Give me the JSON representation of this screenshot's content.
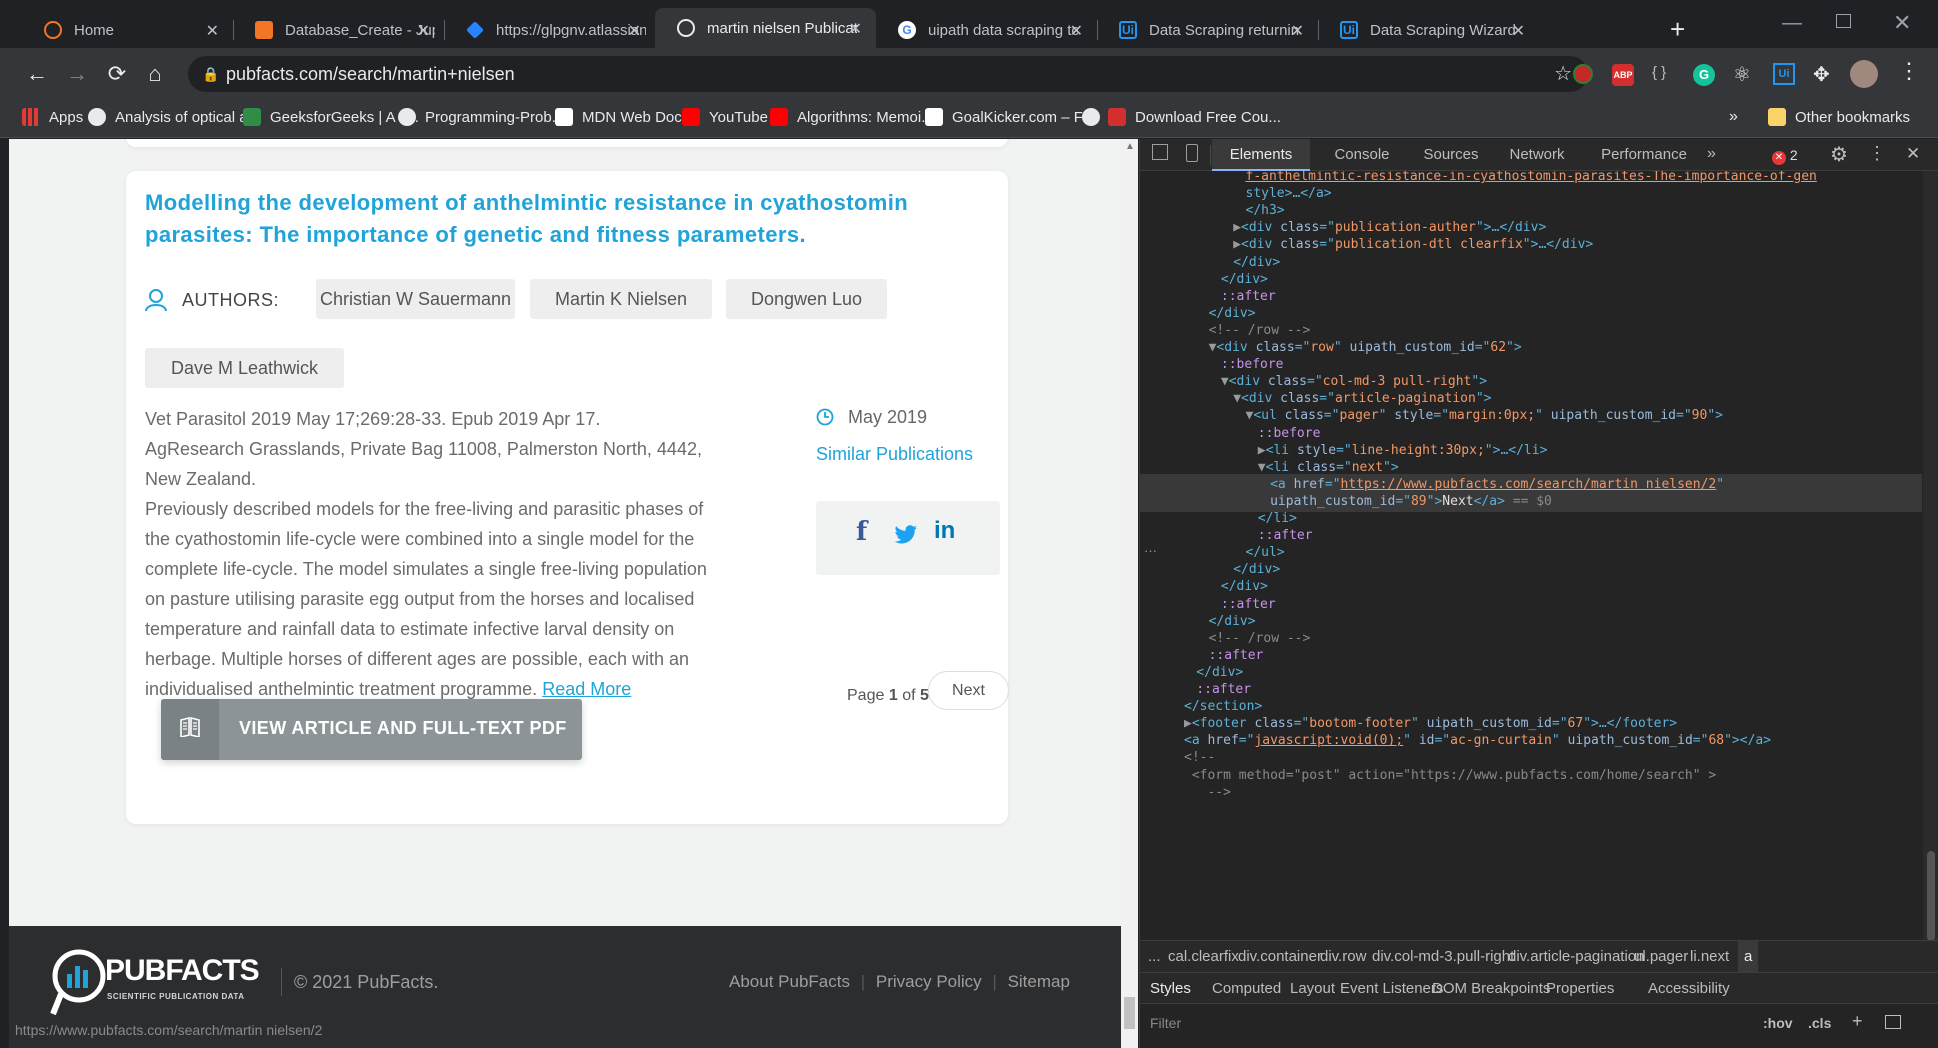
{
  "tabs": [
    {
      "title": "Home",
      "favicon": "jupyter-icon",
      "active": false
    },
    {
      "title": "Database_Create - Jupy",
      "favicon": "notebook-icon",
      "active": false
    },
    {
      "title": "https://glpgnv.atlassian",
      "favicon": "jira-icon",
      "active": false
    },
    {
      "title": "martin nielsen Publicat",
      "favicon": "pubfacts-icon",
      "active": true
    },
    {
      "title": "uipath data scraping to",
      "favicon": "google-icon",
      "active": false
    },
    {
      "title": "Data Scraping returnin",
      "favicon": "uipath-icon",
      "active": false
    },
    {
      "title": "Data Scraping Wizard c",
      "favicon": "uipath-icon",
      "active": false
    }
  ],
  "toolbar": {
    "url": "pubfacts.com/search/martin+nielsen",
    "ext_abp": "ABP",
    "ext_bracket": "{ }",
    "ext_grammarly": "G",
    "ext_ui": "Ui"
  },
  "bookmarks": [
    {
      "label": "Apps",
      "icon": "apps-grid-icon"
    },
    {
      "label": "Analysis of optical a...",
      "icon": "globe-icon"
    },
    {
      "label": "GeeksforGeeks | A c...",
      "icon": "gfg-icon"
    },
    {
      "label": "Programming-Prob...",
      "icon": "github-icon"
    },
    {
      "label": "MDN Web Docs",
      "icon": "mdn-icon"
    },
    {
      "label": "YouTube",
      "icon": "youtube-icon"
    },
    {
      "label": "Algorithms: Memoi...",
      "icon": "youtube-icon"
    },
    {
      "label": "GoalKicker.com – Fr...",
      "icon": "goalkicker-icon"
    },
    {
      "label": "",
      "icon": "globe-icon"
    },
    {
      "label": "Download Free Cou...",
      "icon": "fco-icon"
    }
  ],
  "bookmarks_overflow": "»",
  "other_bookmarks": "Other bookmarks",
  "article": {
    "title_line1": "Modelling the development of anthelmintic resistance in cyathostomin",
    "title_line2": "parasites: The importance of genetic and fitness parameters.",
    "authors_label": "AUTHORS:",
    "authors": [
      "Christian W Sauermann",
      "Martin K Nielsen",
      "Dongwen Luo",
      "Dave M Leathwick"
    ],
    "citation": "Vet Parasitol 2019 May 17;269:28-33. Epub 2019 Apr 17.",
    "affiliation_line1": "AgResearch Grasslands, Private Bag 11008, Palmerston North, 4442,",
    "affiliation_line2": "New Zealand.",
    "abstract_lines": [
      "Previously described models for the free-living and parasitic phases of",
      "the cyathostomin life-cycle were combined into a single model for the",
      "complete life-cycle. The model simulates a single free-living population",
      "on pasture utilising parasite egg output from the horses and localised",
      "temperature and rainfall data to estimate infective larval density on",
      "herbage. Multiple horses of different ages are possible, each with an",
      "individualised anthelmintic treatment programme."
    ],
    "read_more": "Read More",
    "date": "May 2019",
    "similar": "Similar Publications",
    "view_button": "VIEW ARTICLE AND FULL-TEXT PDF"
  },
  "pagination": {
    "page_label": "Page",
    "current": "1",
    "of_label": "of",
    "total": "5",
    "next": "Next"
  },
  "footer": {
    "logo_text": "PUBFACTS",
    "logo_sub": "SCIENTIFIC PUBLICATION DATA",
    "copyright": "© 2021 PubFacts.",
    "links": [
      "About PubFacts",
      "Privacy Policy",
      "Sitemap"
    ]
  },
  "status_url": "https://www.pubfacts.com/search/martin nielsen/2",
  "devtools": {
    "tabs": [
      "Elements",
      "Console",
      "Sources",
      "Network",
      "Performance"
    ],
    "more_tabs": "»",
    "error_count": "2",
    "breadcrumbs": [
      "...",
      "cal.clearfix",
      "div.container",
      "div.row",
      "div.col-md-3.pull-right",
      "div.article-pagination",
      "ul.pager",
      "li.next",
      "a"
    ],
    "bottom_tabs": [
      "Styles",
      "Computed",
      "Layout",
      "Event Listeners",
      "DOM Breakpoints",
      "Properties",
      "Accessibility"
    ],
    "filter_placeholder": "Filter",
    "filter_hov": ":hov",
    "filter_cls": ".cls",
    "code_lines": [
      {
        "indent": 5,
        "html": "<span class='link'>f-anthelmintic-resistance-in-cyathostomin-parasites-The-importance-of-gen</span>"
      },
      {
        "indent": 5,
        "html": "<span class='tag'>style&gt;…&lt;/a&gt;</span>"
      },
      {
        "indent": 5,
        "html": "<span class='tag'>&lt;/h3&gt;</span>"
      },
      {
        "indent": 4,
        "html": "<span class='tri'>▶</span><span class='tag'>&lt;div </span><span class='attr'>class</span><span class='tag'>=\"</span><span class='aval'>publication-auther</span><span class='tag'>\"&gt;…&lt;/div&gt;</span>"
      },
      {
        "indent": 4,
        "html": "<span class='tri'>▶</span><span class='tag'>&lt;div </span><span class='attr'>class</span><span class='tag'>=\"</span><span class='aval'>publication-dtl clearfix</span><span class='tag'>\"&gt;…&lt;/div&gt;</span>"
      },
      {
        "indent": 4,
        "html": "<span class='tag'>&lt;/div&gt;</span>"
      },
      {
        "indent": 3,
        "html": "<span class='tag'>&lt;/div&gt;</span>"
      },
      {
        "indent": 3,
        "html": "<span class='pseudo'>::after</span>"
      },
      {
        "indent": 2,
        "html": "<span class='tag'>&lt;/div&gt;</span>"
      },
      {
        "indent": 2,
        "html": "<span class='cmt'>&lt;!-- /row --&gt;</span>"
      },
      {
        "indent": 2,
        "html": "<span class='tri'>▼</span><span class='tag'>&lt;div </span><span class='attr'>class</span><span class='tag'>=\"</span><span class='aval'>row</span><span class='tag'>\" </span><span class='attr'>uipath_custom_id</span><span class='tag'>=\"</span><span class='aval'>62</span><span class='tag'>\"&gt;</span>"
      },
      {
        "indent": 3,
        "html": "<span class='pseudo'>::before</span>"
      },
      {
        "indent": 3,
        "html": "<span class='tri'>▼</span><span class='tag'>&lt;div </span><span class='attr'>class</span><span class='tag'>=\"</span><span class='aval'>col-md-3 pull-right</span><span class='tag'>\"&gt;</span>"
      },
      {
        "indent": 4,
        "html": "<span class='tri'>▼</span><span class='tag'>&lt;div </span><span class='attr'>class</span><span class='tag'>=\"</span><span class='aval'>article-pagination</span><span class='tag'>\"&gt;</span>"
      },
      {
        "indent": 5,
        "html": "<span class='tri'>▼</span><span class='tag'>&lt;ul </span><span class='attr'>class</span><span class='tag'>=\"</span><span class='aval'>pager</span><span class='tag'>\" </span><span class='attr'>style</span><span class='tag'>=\"</span><span class='aval'>margin:0px;</span><span class='tag'>\" </span><span class='attr'>uipath_custom_id</span><span class='tag'>=\"</span><span class='aval'>90</span><span class='tag'>\"&gt;</span>"
      },
      {
        "indent": 6,
        "html": "<span class='pseudo'>::before</span>"
      },
      {
        "indent": 6,
        "html": "<span class='tri'>▶</span><span class='tag'>&lt;li </span><span class='attr'>style</span><span class='tag'>=\"</span><span class='aval'>line-height:30px;</span><span class='tag'>\"&gt;…&lt;/li&gt;</span>"
      },
      {
        "indent": 6,
        "html": "<span class='tri'>▼</span><span class='tag'>&lt;li </span><span class='attr'>class</span><span class='tag'>=\"</span><span class='aval'>next</span><span class='tag'>\"&gt;</span>"
      },
      {
        "indent": 7,
        "html": "<span class='tag'>&lt;a </span><span class='attr'>href</span><span class='tag'>=\"</span><span class='link'>https://www.pubfacts.com/search/martin nielsen/2</span><span class='tag'>\"</span>",
        "selected": true
      },
      {
        "indent": 7,
        "html": "<span class='attr'>uipath_custom_id</span><span class='tag'>=\"</span><span class='aval'>89</span><span class='tag'>\"&gt;</span><span style='color:#e0e0e0'>Next</span><span class='tag'>&lt;/a&gt;</span><span class='cmt'> == $0</span>",
        "selected": true
      },
      {
        "indent": 6,
        "html": "<span class='tag'>&lt;/li&gt;</span>"
      },
      {
        "indent": 6,
        "html": "<span class='pseudo'>::after</span>"
      },
      {
        "indent": 5,
        "html": "<span class='tag'>&lt;/ul&gt;</span>"
      },
      {
        "indent": 4,
        "html": "<span class='tag'>&lt;/div&gt;</span>"
      },
      {
        "indent": 3,
        "html": "<span class='tag'>&lt;/div&gt;</span>"
      },
      {
        "indent": 3,
        "html": "<span class='pseudo'>::after</span>"
      },
      {
        "indent": 2,
        "html": "<span class='tag'>&lt;/div&gt;</span>"
      },
      {
        "indent": 2,
        "html": "<span class='cmt'>&lt;!-- /row --&gt;</span>"
      },
      {
        "indent": 2,
        "html": "<span class='pseudo'>::after</span>"
      },
      {
        "indent": 1,
        "html": "<span class='tag'>&lt;/div&gt;</span>"
      },
      {
        "indent": 1,
        "html": "<span class='pseudo'>::after</span>"
      },
      {
        "indent": 0,
        "html": "<span class='tag'>&lt;/section&gt;</span>"
      },
      {
        "indent": 0,
        "html": "<span class='tri'>▶</span><span class='tag'>&lt;footer </span><span class='attr'>class</span><span class='tag'>=\"</span><span class='aval'>bootom-footer</span><span class='tag'>\" </span><span class='attr'>uipath_custom_id</span><span class='tag'>=\"</span><span class='aval'>67</span><span class='tag'>\"&gt;…&lt;/footer&gt;</span>"
      },
      {
        "indent": 0,
        "html": "<span class='tag'>&lt;a </span><span class='attr'>href</span><span class='tag'>=\"</span><span class='link'>javascript:void(0);</span><span class='tag'>\" </span><span class='attr'>id</span><span class='tag'>=\"</span><span class='aval'>ac-gn-curtain</span><span class='tag'>\" </span><span class='attr'>uipath_custom_id</span><span class='tag'>=\"</span><span class='aval'>68</span><span class='tag'>\"&gt;&lt;/a&gt;</span>"
      },
      {
        "indent": 0,
        "html": "<span class='cmt'>&lt;!--</span>"
      },
      {
        "indent": 0,
        "html": "<span class='cmt'> &lt;form method=\"post\" action=\"https://www.pubfacts.com/home/search\" &gt;</span>"
      },
      {
        "indent": 0,
        "html": "<span class='cmt'>   --&gt;</span>"
      }
    ]
  },
  "colors": {
    "title_blue": "#1fa3d8",
    "button_gray": "#8c9498",
    "devtools_bg": "#242424",
    "chrome_dark": "#202124"
  }
}
